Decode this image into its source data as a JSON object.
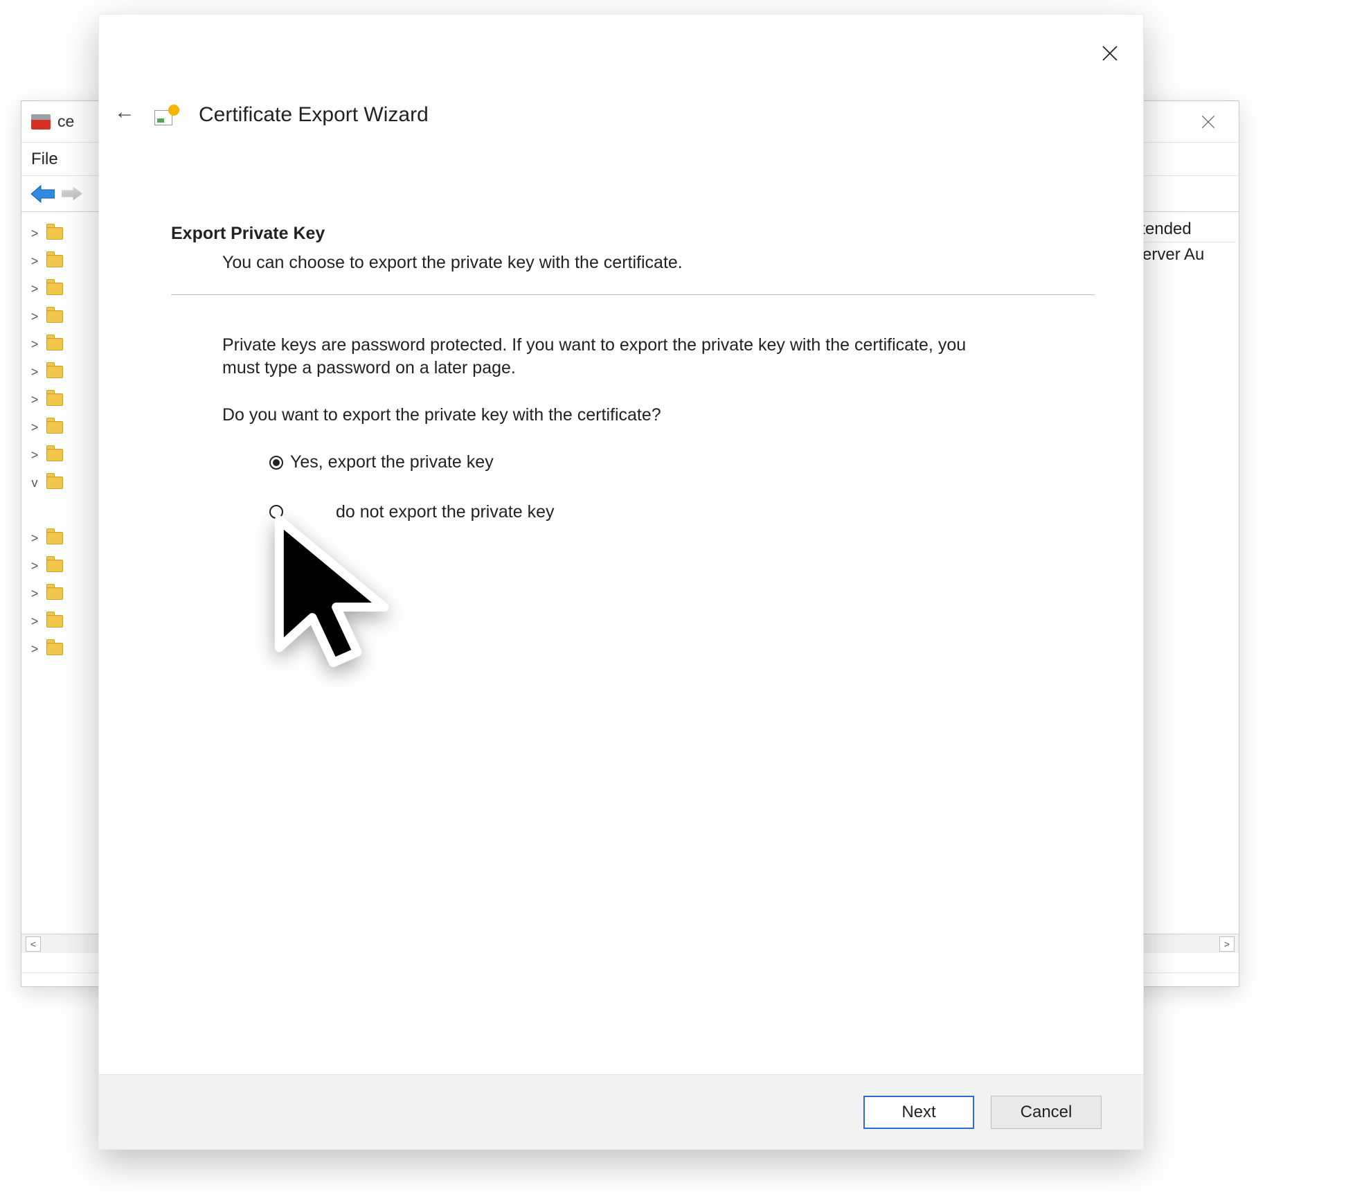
{
  "mmc": {
    "title_fragment": "ce",
    "menu": {
      "file": "File"
    },
    "right_panel": {
      "col_intended": "ntended",
      "col_server": "Server Au"
    },
    "tree": [
      {
        "expander": ">"
      },
      {
        "expander": ">"
      },
      {
        "expander": ">"
      },
      {
        "expander": ">"
      },
      {
        "expander": ">"
      },
      {
        "expander": ">"
      },
      {
        "expander": ">"
      },
      {
        "expander": ">"
      },
      {
        "expander": ">"
      },
      {
        "expander": "v"
      },
      {
        "expander": ""
      },
      {
        "expander": ">"
      },
      {
        "expander": ">"
      },
      {
        "expander": ">"
      },
      {
        "expander": ">"
      },
      {
        "expander": ">"
      }
    ]
  },
  "wizard": {
    "title": "Certificate Export Wizard",
    "section_title": "Export Private Key",
    "section_subtitle": "You can choose to export the private key with the certificate.",
    "paragraph": "Private keys are password protected. If you want to export the private key with the certificate, you must type a password on a later page.",
    "question": "Do you want to export the private key with the certificate?",
    "options": {
      "yes": "Yes, export the private key",
      "no_partial": "do not export the private key"
    },
    "buttons": {
      "next": "Next",
      "cancel": "Cancel"
    }
  }
}
